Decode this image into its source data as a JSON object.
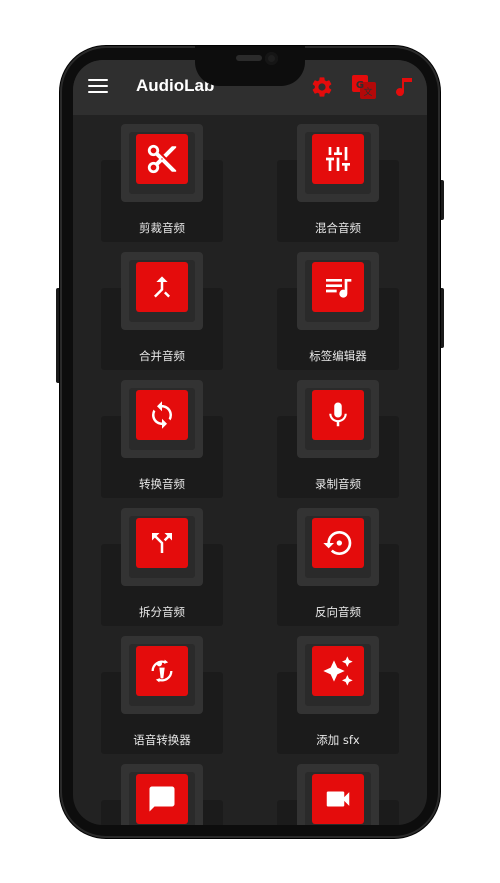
{
  "app": {
    "title": "AudioLab",
    "accent": "#e40c0c",
    "bar_bg": "#2f2f2f",
    "screen_bg": "#222222"
  },
  "appbar": {
    "menu_icon": "menu-icon",
    "actions": [
      "settings-icon",
      "translate-icon",
      "music-note-icon"
    ]
  },
  "tools": [
    {
      "label": "剪裁音频",
      "icon": "scissors-icon"
    },
    {
      "label": "混合音频",
      "icon": "equalizer-sliders-icon"
    },
    {
      "label": "合并音频",
      "icon": "merge-arrow-icon"
    },
    {
      "label": "标签编辑器",
      "icon": "playlist-music-icon"
    },
    {
      "label": "转换音频",
      "icon": "sync-icon"
    },
    {
      "label": "录制音频",
      "icon": "microphone-icon"
    },
    {
      "label": "拆分音频",
      "icon": "split-arrow-icon"
    },
    {
      "label": "反向音频",
      "icon": "restore-icon"
    },
    {
      "label": "语音转换器",
      "icon": "voice-change-icon"
    },
    {
      "label": "添加 sfx",
      "icon": "sparkles-icon"
    },
    {
      "label": "",
      "icon": "feedback-icon"
    },
    {
      "label": "",
      "icon": "video-audio-icon"
    }
  ]
}
